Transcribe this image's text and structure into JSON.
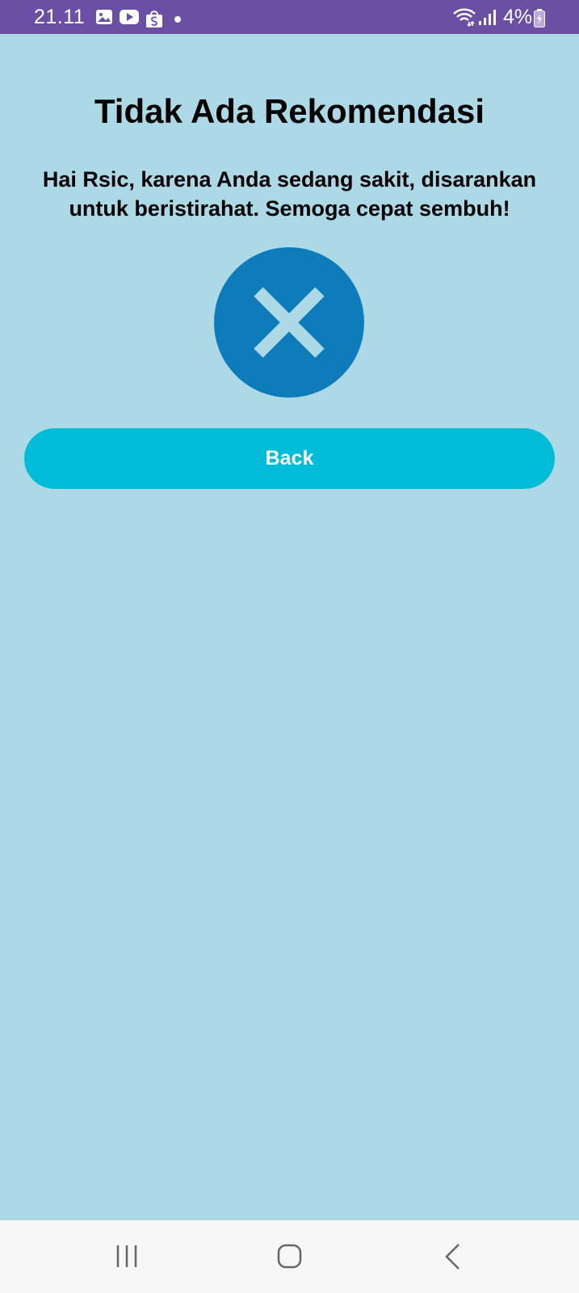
{
  "status_bar": {
    "time": "21.11",
    "icons": [
      "gallery-icon",
      "youtube-icon",
      "shopee-icon",
      "notification-dot-icon",
      "wifi-icon",
      "signal-icon",
      "battery-charging-icon"
    ],
    "battery": "4%"
  },
  "main": {
    "title": "Tidak Ada Rekomendasi",
    "message": "Hai Rsic, karena Anda sedang sakit, disarankan untuk beristirahat. Semoga cepat sembuh!",
    "status_icon": "close-icon",
    "back_label": "Back"
  },
  "nav_bar": {
    "buttons": [
      "recents-icon",
      "home-icon",
      "back-arrow-icon"
    ]
  },
  "colors": {
    "status_bar": "#6A4FA5",
    "background": "#ADD8E6",
    "icon_circle": "#0E7BBA",
    "button": "#00BCD6",
    "nav_bar": "#F7F7F7"
  }
}
